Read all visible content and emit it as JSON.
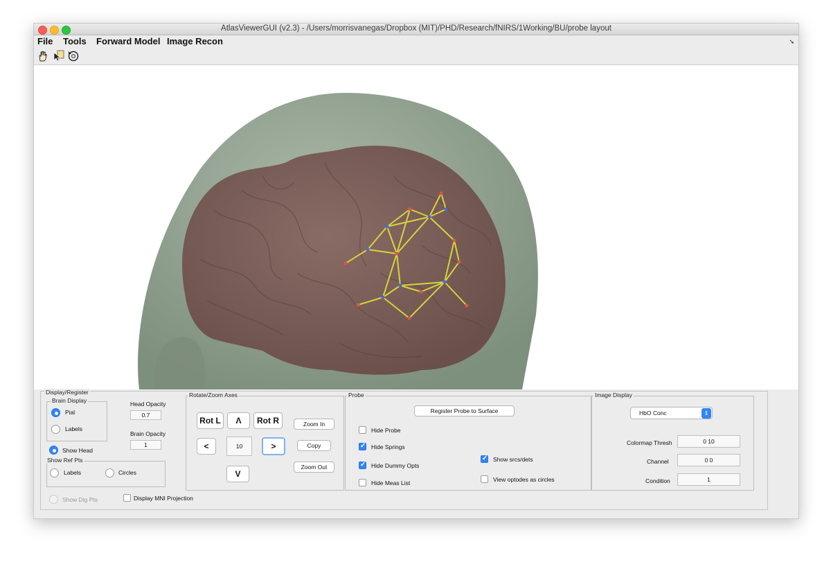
{
  "window": {
    "title": "AtlasViewerGUI  (v2.3) - /Users/morrisvanegas/Dropbox (MIT)/PHD/Research/fNIRS/1Working/BU/probe layout"
  },
  "menubar": {
    "items": [
      "File",
      "Tools",
      "Forward Model",
      "Image Recon"
    ],
    "overflow_icon": "chevron-right-icon"
  },
  "toolbar": {
    "tools": [
      "hand-pan-icon",
      "data-cursor-icon",
      "rotate-3d-icon"
    ]
  },
  "scene": {
    "colors": {
      "head": "#8c9d8c",
      "brain": "#7b5e58",
      "probe_spring": "#d8d43a",
      "source": "#d8564a",
      "detector": "#4a6ad8"
    }
  },
  "display_register": {
    "title": "Display/Register",
    "brain_display": {
      "title": "Brain Display",
      "pial_label": "Pial",
      "pial_selected": true,
      "labels_label": "Labels",
      "labels_selected": false
    },
    "head_opacity_label": "Head Opacity",
    "head_opacity_value": "0.7",
    "brain_opacity_label": "Brain Opacity",
    "brain_opacity_value": "1",
    "show_head_label": "Show Head",
    "show_head_selected": true,
    "show_ref_pts": {
      "title": "Show Ref Pts",
      "labels_label": "Labels",
      "circles_label": "Circles"
    },
    "show_dig_pts_label": "Show Dig Pts",
    "display_mni_label": "Display MNI Projection"
  },
  "rotate_zoom": {
    "title": "Rotate/Zoom Axes",
    "rot_l": "Rot L",
    "up": "Λ",
    "rot_r": "Rot R",
    "left": "<",
    "step_value": "10",
    "right": ">",
    "down": "V",
    "zoom_in": "Zoom In",
    "copy": "Copy",
    "zoom_out": "Zoom Out"
  },
  "probe": {
    "title": "Probe",
    "register_label": "Register Probe to Surface",
    "hide_probe_label": "Hide Probe",
    "hide_probe_checked": false,
    "hide_springs_label": "Hide Springs",
    "hide_springs_checked": true,
    "hide_dummy_label": "Hide Dummy Opts",
    "hide_dummy_checked": true,
    "hide_meas_label": "Hide Meas List",
    "hide_meas_checked": false,
    "show_srcs_label": "Show srcs/dets",
    "show_srcs_checked": true,
    "view_circles_label": "View optodes as circles",
    "view_circles_checked": false
  },
  "image_display": {
    "title": "Image Display",
    "select_value": "HbO Conc",
    "colormap_label": "Colormap Thresh",
    "colormap_value": "0 10",
    "channel_label": "Channel",
    "channel_value": "0 0",
    "condition_label": "Condition",
    "condition_value": "1"
  }
}
